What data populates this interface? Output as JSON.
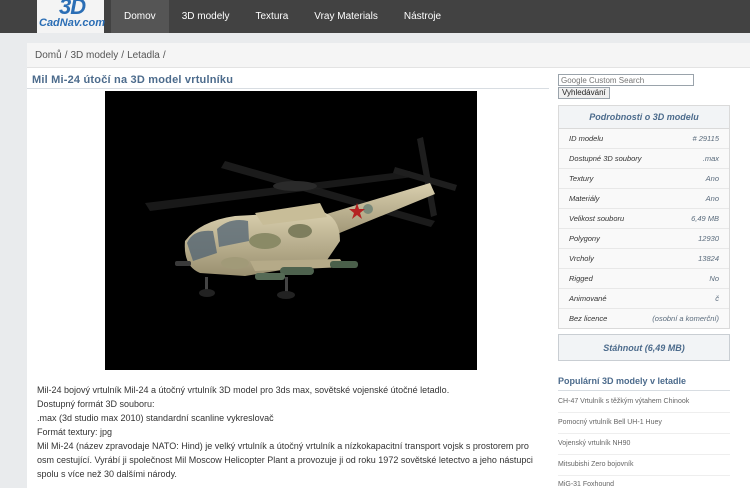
{
  "logo": {
    "mark": "3D",
    "text": "CadNav.com"
  },
  "nav": [
    "Domov",
    "3D modely",
    "Textura",
    "Vray Materials",
    "Nástroje"
  ],
  "breadcrumb": [
    "Domů",
    "3D modely",
    "Letadla"
  ],
  "page_title": "Mil Mi-24 útočí na 3D model vrtulníku",
  "search": {
    "placeholder": "Google Custom Search",
    "button": "Vyhledávání"
  },
  "details": {
    "title": "Podrobnosti o 3D modelu",
    "rows": [
      {
        "k": "ID modelu",
        "v": "# 29115"
      },
      {
        "k": "Dostupné 3D soubory",
        "v": ".max"
      },
      {
        "k": "Textury",
        "v": "Ano"
      },
      {
        "k": "Materiály",
        "v": "Ano"
      },
      {
        "k": "Velikost souboru",
        "v": "6,49 MB"
      },
      {
        "k": "Polygony",
        "v": "12930"
      },
      {
        "k": "Vrcholy",
        "v": "13824"
      },
      {
        "k": "Rigged",
        "v": "No"
      },
      {
        "k": "Animované",
        "v": "č"
      },
      {
        "k": "Bez licence",
        "v": "(osobní a komerční)"
      }
    ]
  },
  "download": "Stáhnout (6,49 MB)",
  "popular": {
    "title": "Populární 3D modely v letadle",
    "items": [
      "CH-47 Vrtulník s těžkým výtahem Chinook",
      "Pomocný vrtulník Bell UH-1 Huey",
      "Vojenský vrtulník NH90",
      "Mitsubishi Zero bojovník",
      "MiG-31 Foxhound"
    ]
  },
  "description": [
    "Mil-24 bojový vrtulník Mil-24 a útočný vrtulník 3D model pro 3ds max, sovětské vojenské útočné letadlo.",
    "Dostupný formát 3D souboru:",
    ".max (3d studio max 2010) standardní scanline vykreslovač",
    "Formát textury: jpg",
    "Mil Mi-24 (název zpravodaje NATO: Hind) je velký vrtulník a útočný vrtulník a nízkokapacitní transport vojsk s prostorem pro osm cestující. Vyrábí ji společnost Mil Moscow Helicopter Plant a provozuje ji od roku 1972 sovětské letectvo a jeho nástupci spolu s více než 30 dalšími národy."
  ]
}
